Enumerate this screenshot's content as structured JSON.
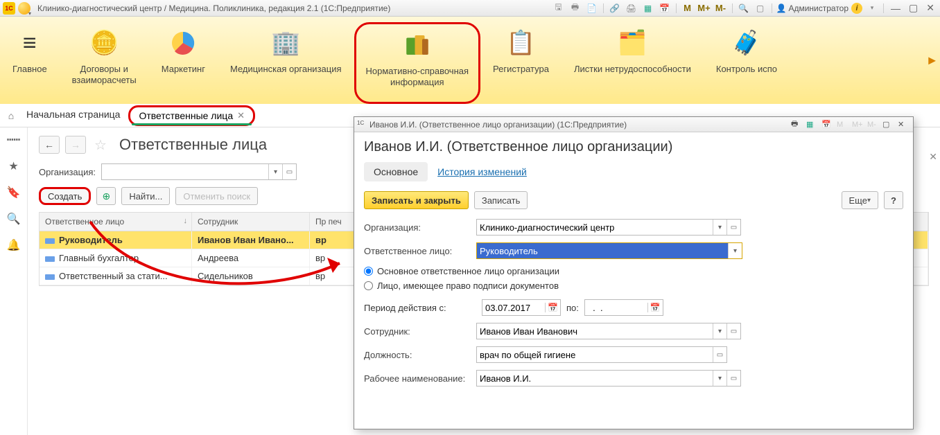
{
  "titlebar": {
    "app": "1C",
    "title": "Клинико-диагностический центр / Медицина. Поликлиника, редакция 2.1  (1С:Предприятие)",
    "m_buttons": [
      "M",
      "M+",
      "M-"
    ],
    "user": "Администратор"
  },
  "toolbar": {
    "items": [
      {
        "label": "Главное"
      },
      {
        "label": "Договоры и\nвзаиморасчеты"
      },
      {
        "label": "Маркетинг"
      },
      {
        "label": "Медицинская организация"
      },
      {
        "label": "Нормативно-справочная\nинформация"
      },
      {
        "label": "Регистратура"
      },
      {
        "label": "Листки нетрудоспособности"
      },
      {
        "label": "Контроль испо"
      }
    ]
  },
  "tabs": {
    "home": "Начальная страница",
    "active": "Ответственные лица"
  },
  "list": {
    "title": "Ответственные лица",
    "org_label": "Организация:",
    "org_value": "",
    "create": "Создать",
    "find": "Найти...",
    "cancel_find": "Отменить поиск",
    "columns": [
      "Ответственное лицо",
      "Сотрудник",
      "Пр\nпеч"
    ],
    "rows": [
      {
        "role": "Руководитель",
        "emp": "Иванов Иван Ивано...",
        "flag": "вр"
      },
      {
        "role": "Главный бухгалтер",
        "emp": "Андреева",
        "flag": "вр"
      },
      {
        "role": "Ответственный за стати...",
        "emp": "Сидельников",
        "flag": "вр"
      }
    ]
  },
  "dialog": {
    "win_title": "Иванов И.И. (Ответственное лицо организации)  (1С:Предприятие)",
    "header": "Иванов И.И. (Ответственное лицо организации)",
    "tab_main": "Основное",
    "tab_history": "История изменений",
    "save_close": "Записать и закрыть",
    "save": "Записать",
    "more": "Еще",
    "help": "?",
    "fields": {
      "org_label": "Организация:",
      "org_value": "Клинико-диагностический центр",
      "resp_label": "Ответственное лицо:",
      "resp_value": "Руководитель",
      "radio1": "Основное ответственное лицо организации",
      "radio2": "Лицо, имеющее право подписи документов",
      "period_label": "Период действия с:",
      "period_from": "03.07.2017",
      "period_to_label": "по:",
      "period_to": "  .  .",
      "emp_label": "Сотрудник:",
      "emp_value": "Иванов Иван Иванович",
      "pos_label": "Должность:",
      "pos_value": "врач по общей гигиене",
      "workname_label": "Рабочее наименование:",
      "workname_value": "Иванов И.И."
    }
  }
}
